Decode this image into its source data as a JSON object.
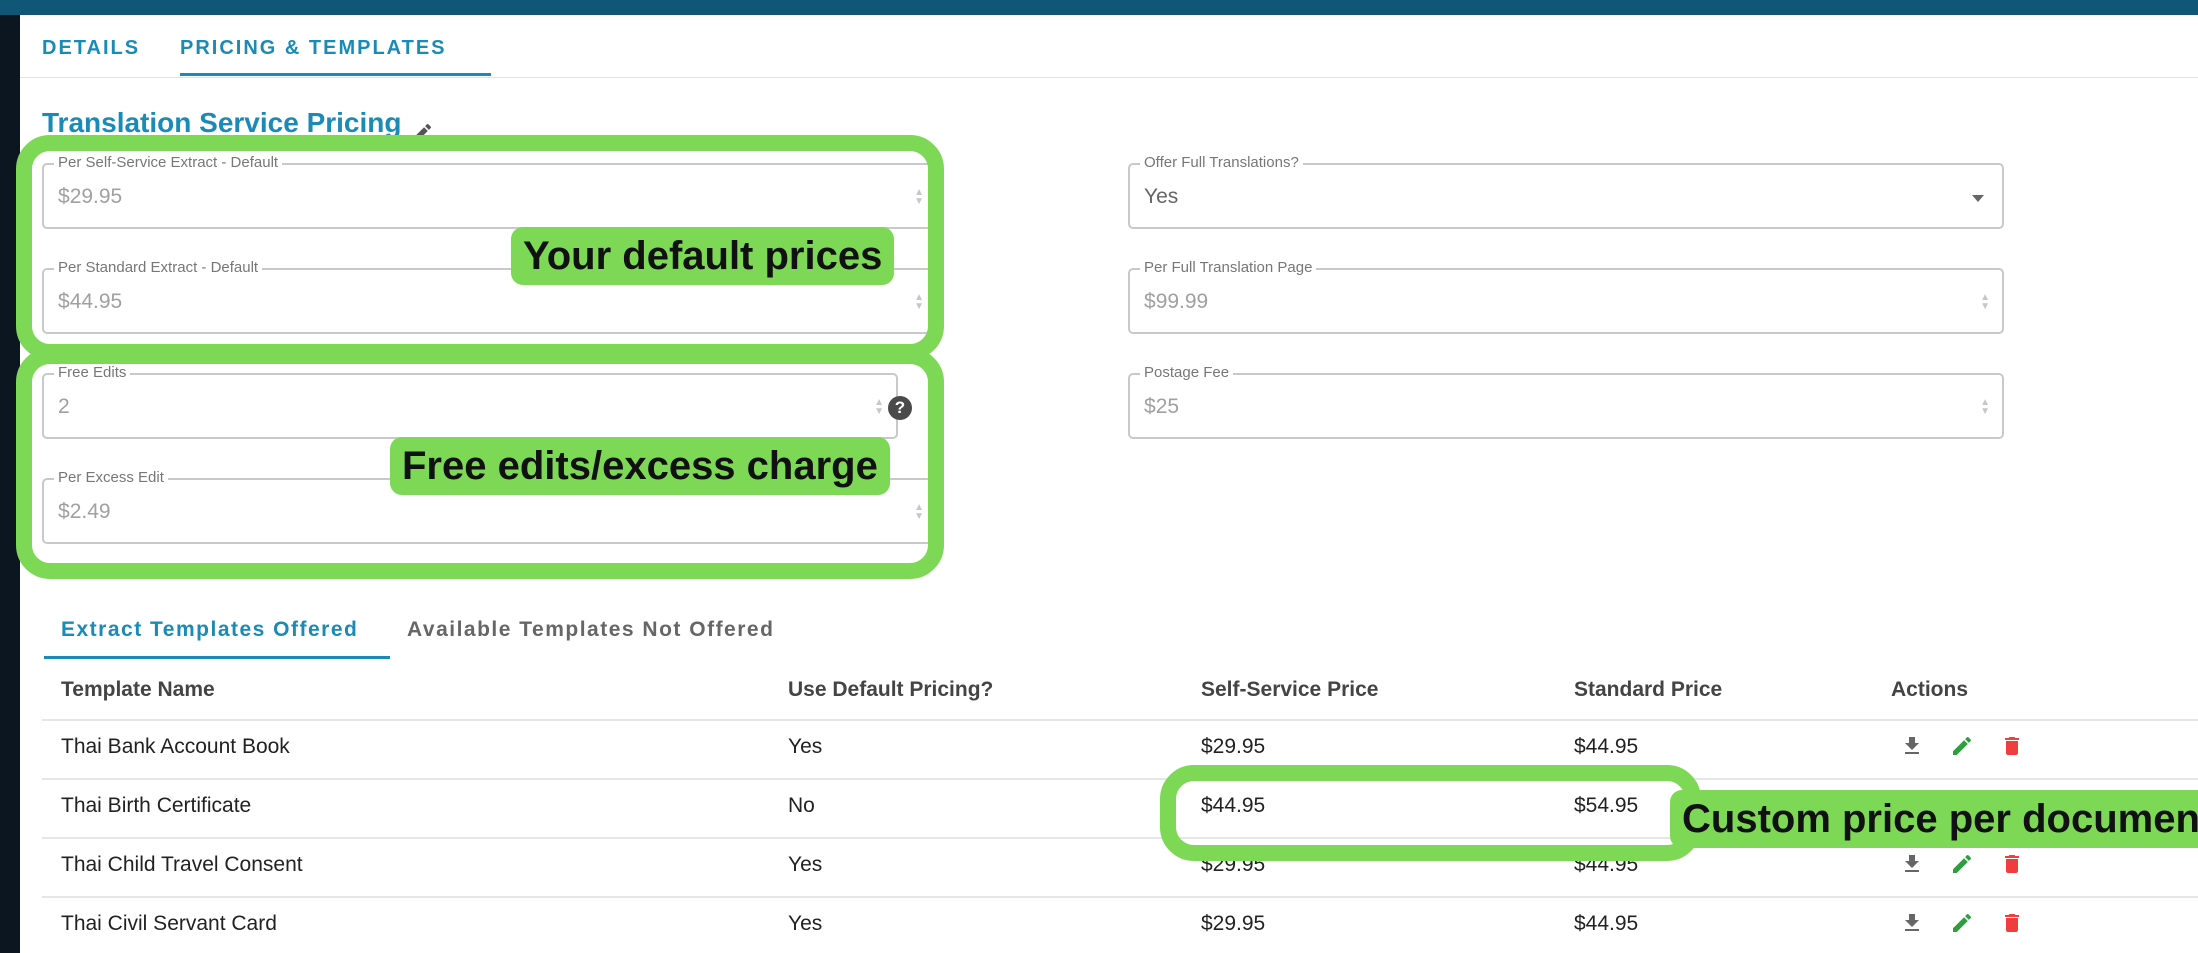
{
  "tabs": [
    {
      "label": "DETAILS"
    },
    {
      "label": "PRICING & TEMPLATES"
    }
  ],
  "section_title": "Translation Service Pricing",
  "left_fields": [
    {
      "label": "Per Self-Service Extract - Default",
      "currency": "$",
      "value": "29.95"
    },
    {
      "label": "Per Standard Extract - Default",
      "currency": "$",
      "value": "44.95"
    },
    {
      "label": "Free Edits",
      "currency": "",
      "value": "2"
    },
    {
      "label": "Per Excess Edit",
      "currency": "$",
      "value": "2.49"
    }
  ],
  "right_fields": [
    {
      "label": "Offer Full Translations?",
      "currency": "",
      "value": "Yes"
    },
    {
      "label": "Per Full Translation Page",
      "currency": "$",
      "value": "99.99"
    },
    {
      "label": "Postage Fee",
      "currency": "$",
      "value": "25"
    }
  ],
  "help_icon_glyph": "?",
  "template_tabs": [
    {
      "label": "Extract Templates Offered"
    },
    {
      "label": "Available Templates Not Offered"
    }
  ],
  "table": {
    "columns": [
      "Template Name",
      "Use Default Pricing?",
      "Self-Service Price",
      "Standard Price",
      "Actions"
    ],
    "rows": [
      {
        "name": "Thai Bank Account Book",
        "use_default": "Yes",
        "self_service": "$29.95",
        "standard": "$44.95"
      },
      {
        "name": "Thai Birth Certificate",
        "use_default": "No",
        "self_service": "$44.95",
        "standard": "$54.95"
      },
      {
        "name": "Thai Child Travel Consent",
        "use_default": "Yes",
        "self_service": "$29.95",
        "standard": "$44.95"
      },
      {
        "name": "Thai Civil Servant Card",
        "use_default": "Yes",
        "self_service": "$29.95",
        "standard": "$44.95"
      }
    ]
  },
  "annotations": {
    "default_prices": "Your default prices",
    "free_edits": "Free edits/excess charge",
    "custom_price": "Custom price per document"
  },
  "colors": {
    "accent": "#1a8ab7",
    "highlight": "#7dd856",
    "edit_icon": "#2e9e3e",
    "delete_icon": "#f03e3e",
    "background": "#0d1b27"
  }
}
